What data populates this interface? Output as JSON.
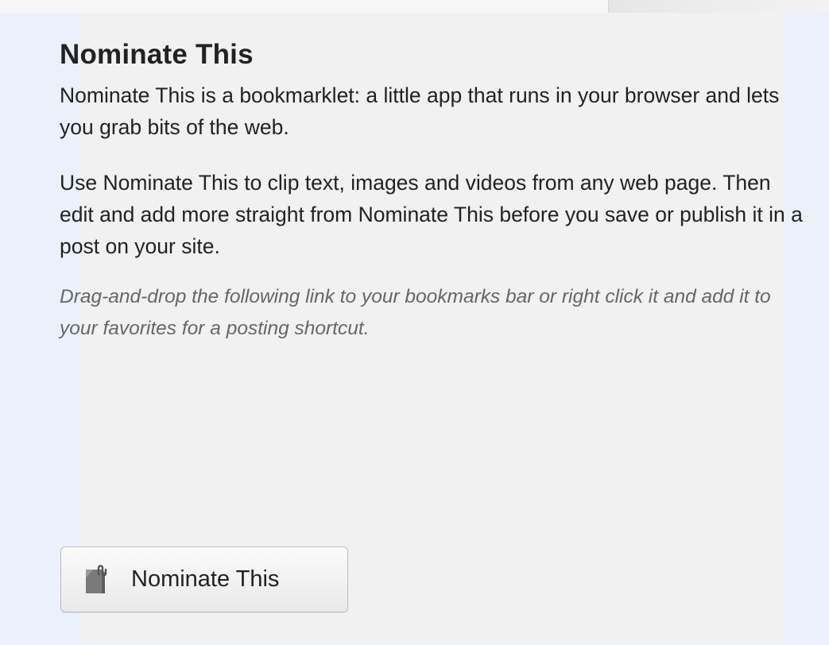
{
  "box": {
    "title": "Nominate This",
    "paragraph_1": "Nominate This is a bookmarklet: a little app that runs in your browser and lets you grab bits of the web.",
    "paragraph_2": "Use Nominate This to clip text, images and videos from any web page. Then edit and add more straight from Nominate This before you save or publish it in a post on your site.",
    "note": "Drag-and-drop the following link to your bookmarks bar or right click it and add it to your favorites for a posting shortcut."
  },
  "bookmarklet": {
    "label": "Nominate This",
    "icon": "nominate-this-icon"
  },
  "colors": {
    "page_background": "#eaf1fa",
    "card_background": "#f1f1f1",
    "text": "#222222",
    "note_text": "#666666",
    "button_border": "#bdbdbd"
  }
}
